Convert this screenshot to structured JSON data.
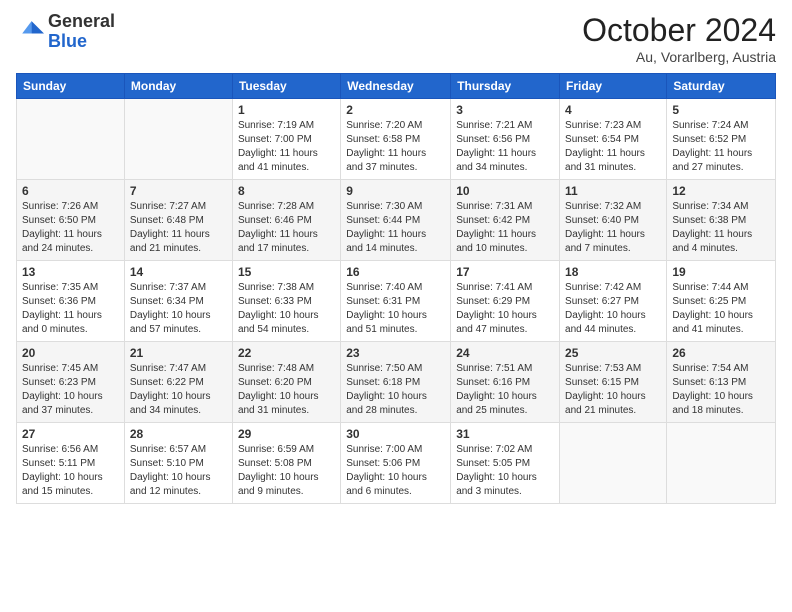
{
  "header": {
    "logo_general": "General",
    "logo_blue": "Blue",
    "month_title": "October 2024",
    "location": "Au, Vorarlberg, Austria"
  },
  "days_of_week": [
    "Sunday",
    "Monday",
    "Tuesday",
    "Wednesday",
    "Thursday",
    "Friday",
    "Saturday"
  ],
  "weeks": [
    [
      {
        "day": "",
        "sunrise": "",
        "sunset": "",
        "daylight": ""
      },
      {
        "day": "",
        "sunrise": "",
        "sunset": "",
        "daylight": ""
      },
      {
        "day": "1",
        "sunrise": "Sunrise: 7:19 AM",
        "sunset": "Sunset: 7:00 PM",
        "daylight": "Daylight: 11 hours and 41 minutes."
      },
      {
        "day": "2",
        "sunrise": "Sunrise: 7:20 AM",
        "sunset": "Sunset: 6:58 PM",
        "daylight": "Daylight: 11 hours and 37 minutes."
      },
      {
        "day": "3",
        "sunrise": "Sunrise: 7:21 AM",
        "sunset": "Sunset: 6:56 PM",
        "daylight": "Daylight: 11 hours and 34 minutes."
      },
      {
        "day": "4",
        "sunrise": "Sunrise: 7:23 AM",
        "sunset": "Sunset: 6:54 PM",
        "daylight": "Daylight: 11 hours and 31 minutes."
      },
      {
        "day": "5",
        "sunrise": "Sunrise: 7:24 AM",
        "sunset": "Sunset: 6:52 PM",
        "daylight": "Daylight: 11 hours and 27 minutes."
      }
    ],
    [
      {
        "day": "6",
        "sunrise": "Sunrise: 7:26 AM",
        "sunset": "Sunset: 6:50 PM",
        "daylight": "Daylight: 11 hours and 24 minutes."
      },
      {
        "day": "7",
        "sunrise": "Sunrise: 7:27 AM",
        "sunset": "Sunset: 6:48 PM",
        "daylight": "Daylight: 11 hours and 21 minutes."
      },
      {
        "day": "8",
        "sunrise": "Sunrise: 7:28 AM",
        "sunset": "Sunset: 6:46 PM",
        "daylight": "Daylight: 11 hours and 17 minutes."
      },
      {
        "day": "9",
        "sunrise": "Sunrise: 7:30 AM",
        "sunset": "Sunset: 6:44 PM",
        "daylight": "Daylight: 11 hours and 14 minutes."
      },
      {
        "day": "10",
        "sunrise": "Sunrise: 7:31 AM",
        "sunset": "Sunset: 6:42 PM",
        "daylight": "Daylight: 11 hours and 10 minutes."
      },
      {
        "day": "11",
        "sunrise": "Sunrise: 7:32 AM",
        "sunset": "Sunset: 6:40 PM",
        "daylight": "Daylight: 11 hours and 7 minutes."
      },
      {
        "day": "12",
        "sunrise": "Sunrise: 7:34 AM",
        "sunset": "Sunset: 6:38 PM",
        "daylight": "Daylight: 11 hours and 4 minutes."
      }
    ],
    [
      {
        "day": "13",
        "sunrise": "Sunrise: 7:35 AM",
        "sunset": "Sunset: 6:36 PM",
        "daylight": "Daylight: 11 hours and 0 minutes."
      },
      {
        "day": "14",
        "sunrise": "Sunrise: 7:37 AM",
        "sunset": "Sunset: 6:34 PM",
        "daylight": "Daylight: 10 hours and 57 minutes."
      },
      {
        "day": "15",
        "sunrise": "Sunrise: 7:38 AM",
        "sunset": "Sunset: 6:33 PM",
        "daylight": "Daylight: 10 hours and 54 minutes."
      },
      {
        "day": "16",
        "sunrise": "Sunrise: 7:40 AM",
        "sunset": "Sunset: 6:31 PM",
        "daylight": "Daylight: 10 hours and 51 minutes."
      },
      {
        "day": "17",
        "sunrise": "Sunrise: 7:41 AM",
        "sunset": "Sunset: 6:29 PM",
        "daylight": "Daylight: 10 hours and 47 minutes."
      },
      {
        "day": "18",
        "sunrise": "Sunrise: 7:42 AM",
        "sunset": "Sunset: 6:27 PM",
        "daylight": "Daylight: 10 hours and 44 minutes."
      },
      {
        "day": "19",
        "sunrise": "Sunrise: 7:44 AM",
        "sunset": "Sunset: 6:25 PM",
        "daylight": "Daylight: 10 hours and 41 minutes."
      }
    ],
    [
      {
        "day": "20",
        "sunrise": "Sunrise: 7:45 AM",
        "sunset": "Sunset: 6:23 PM",
        "daylight": "Daylight: 10 hours and 37 minutes."
      },
      {
        "day": "21",
        "sunrise": "Sunrise: 7:47 AM",
        "sunset": "Sunset: 6:22 PM",
        "daylight": "Daylight: 10 hours and 34 minutes."
      },
      {
        "day": "22",
        "sunrise": "Sunrise: 7:48 AM",
        "sunset": "Sunset: 6:20 PM",
        "daylight": "Daylight: 10 hours and 31 minutes."
      },
      {
        "day": "23",
        "sunrise": "Sunrise: 7:50 AM",
        "sunset": "Sunset: 6:18 PM",
        "daylight": "Daylight: 10 hours and 28 minutes."
      },
      {
        "day": "24",
        "sunrise": "Sunrise: 7:51 AM",
        "sunset": "Sunset: 6:16 PM",
        "daylight": "Daylight: 10 hours and 25 minutes."
      },
      {
        "day": "25",
        "sunrise": "Sunrise: 7:53 AM",
        "sunset": "Sunset: 6:15 PM",
        "daylight": "Daylight: 10 hours and 21 minutes."
      },
      {
        "day": "26",
        "sunrise": "Sunrise: 7:54 AM",
        "sunset": "Sunset: 6:13 PM",
        "daylight": "Daylight: 10 hours and 18 minutes."
      }
    ],
    [
      {
        "day": "27",
        "sunrise": "Sunrise: 6:56 AM",
        "sunset": "Sunset: 5:11 PM",
        "daylight": "Daylight: 10 hours and 15 minutes."
      },
      {
        "day": "28",
        "sunrise": "Sunrise: 6:57 AM",
        "sunset": "Sunset: 5:10 PM",
        "daylight": "Daylight: 10 hours and 12 minutes."
      },
      {
        "day": "29",
        "sunrise": "Sunrise: 6:59 AM",
        "sunset": "Sunset: 5:08 PM",
        "daylight": "Daylight: 10 hours and 9 minutes."
      },
      {
        "day": "30",
        "sunrise": "Sunrise: 7:00 AM",
        "sunset": "Sunset: 5:06 PM",
        "daylight": "Daylight: 10 hours and 6 minutes."
      },
      {
        "day": "31",
        "sunrise": "Sunrise: 7:02 AM",
        "sunset": "Sunset: 5:05 PM",
        "daylight": "Daylight: 10 hours and 3 minutes."
      },
      {
        "day": "",
        "sunrise": "",
        "sunset": "",
        "daylight": ""
      },
      {
        "day": "",
        "sunrise": "",
        "sunset": "",
        "daylight": ""
      }
    ]
  ]
}
